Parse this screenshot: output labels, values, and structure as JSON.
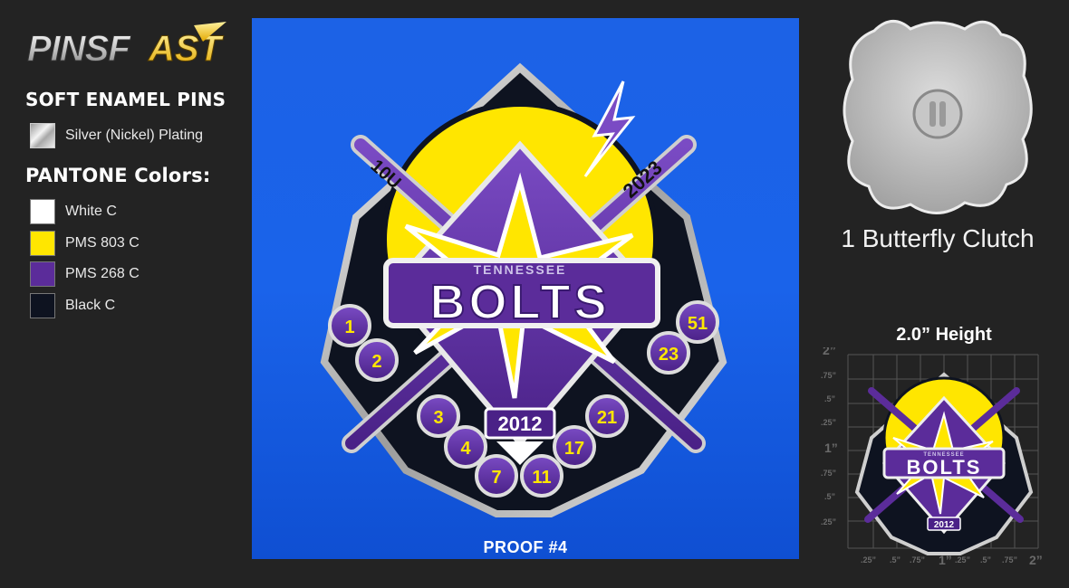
{
  "brand": {
    "logo_text": "PINSFAST"
  },
  "left": {
    "soft_enamel_title": "SOFT ENAMEL PINS",
    "plating_label": "Silver (Nickel) Plating",
    "pantone_title": "PANTONE Colors:",
    "colors": [
      {
        "label": "White C",
        "hex": "#FFFFFF"
      },
      {
        "label": "PMS 803 C",
        "hex": "#FFE600"
      },
      {
        "label": "PMS 268 C",
        "hex": "#5B2C9A"
      },
      {
        "label": "Black C",
        "hex": "#0E1320"
      }
    ]
  },
  "pin": {
    "team_small": "TENNESSEE",
    "team_big": "BOLTS",
    "age_group": "10U",
    "season": "2023",
    "birth_year": "2012",
    "numbers": [
      "1",
      "2",
      "3",
      "4",
      "7",
      "11",
      "17",
      "21",
      "23",
      "51"
    ]
  },
  "proof": {
    "label": "PROOF #4"
  },
  "right": {
    "clutch_label": "1 Butterfly Clutch",
    "height_label": "2.0” Height",
    "ruler_left": [
      "2”",
      ".75”",
      ".5”",
      ".25”",
      "1”",
      ".75”",
      ".5”",
      ".25”"
    ],
    "ruler_bottom": [
      ".25”",
      ".5”",
      ".75”",
      "1”",
      ".25”",
      ".5”",
      ".75”",
      "2”"
    ]
  },
  "colors": {
    "background": "#232323",
    "proof_blue": "#1a63ea",
    "yellow": "#FFE600",
    "purple": "#5B2C9A",
    "silver": "#BDBDBD"
  }
}
